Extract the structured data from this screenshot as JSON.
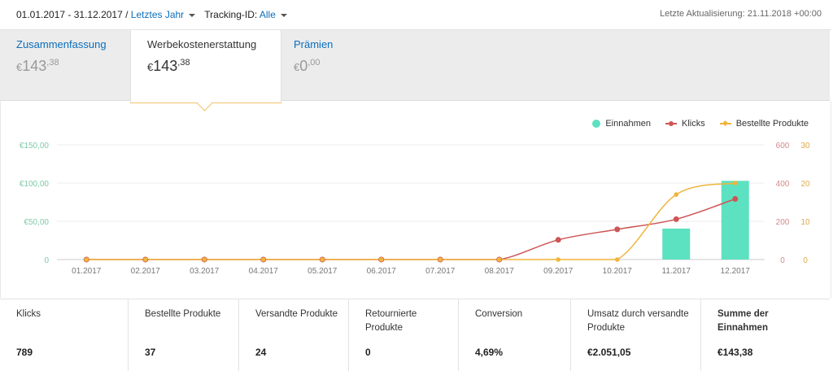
{
  "topbar": {
    "date_range": "01.01.2017 - 31.12.2017 /",
    "period_link": "Letztes Jahr",
    "tracking_label": "Tracking-ID:",
    "tracking_value": "Alle",
    "last_update": "Letzte Aktualisierung: 21.11.2018 +00:00"
  },
  "tabs": [
    {
      "label": "Zusammenfassung",
      "currency": "€",
      "whole": "143",
      "cents": ",38"
    },
    {
      "label": "Werbekostenerstattung",
      "currency": "€",
      "whole": "143",
      "cents": ",38"
    },
    {
      "label": "Prämien",
      "currency": "€",
      "whole": "0",
      "cents": ",00"
    }
  ],
  "legend": {
    "einnahmen": "Einnahmen",
    "klicks": "Klicks",
    "bestellte": "Bestellte Produkte"
  },
  "colors": {
    "einnahmen": "#5ce1c1",
    "klicks": "#cd5555",
    "bestellte": "#f0b43c",
    "link": "#0a6ebd"
  },
  "chart_data": {
    "type": "bar",
    "categories": [
      "01.2017",
      "02.2017",
      "03.2017",
      "04.2017",
      "05.2017",
      "06.2017",
      "07.2017",
      "08.2017",
      "09.2017",
      "10.2017",
      "11.2017",
      "12.2017"
    ],
    "series": [
      {
        "name": "Einnahmen",
        "type": "bar",
        "axis": "left",
        "values": [
          0,
          0,
          0,
          0,
          0,
          0,
          0,
          0,
          0,
          0,
          40.5,
          102.9
        ]
      },
      {
        "name": "Klicks",
        "type": "line",
        "axis": "right1",
        "values": [
          0,
          0,
          0,
          0,
          0,
          0,
          0,
          0,
          103,
          158,
          211,
          317
        ]
      },
      {
        "name": "Bestellte Produkte",
        "type": "line",
        "axis": "right2",
        "values": [
          0,
          0,
          0,
          0,
          0,
          0,
          0,
          0,
          0,
          0,
          17,
          20
        ]
      }
    ],
    "y_left": {
      "ticks": [
        "€150,00",
        "€100,00",
        "€50,00",
        "0"
      ],
      "range": [
        0,
        150
      ]
    },
    "y_right1": {
      "ticks": [
        "600",
        "400",
        "200",
        "0"
      ],
      "range": [
        0,
        600
      ]
    },
    "y_right2": {
      "ticks": [
        "30",
        "20",
        "10",
        "0"
      ],
      "range": [
        0,
        30
      ]
    },
    "grid": true,
    "legend_position": "top-right"
  },
  "stats": [
    {
      "label": "Klicks",
      "value": "789"
    },
    {
      "label": "Bestellte Produkte",
      "value": "37"
    },
    {
      "label": "Versandte Produkte",
      "value": "24"
    },
    {
      "label": "Retournierte Produkte",
      "value": "0"
    },
    {
      "label": "Conversion",
      "value": "4,69%"
    },
    {
      "label": "Umsatz durch versandte Produkte",
      "value": "€2.051,05"
    },
    {
      "label": "Summe der Einnahmen",
      "value": "€143,38"
    }
  ]
}
